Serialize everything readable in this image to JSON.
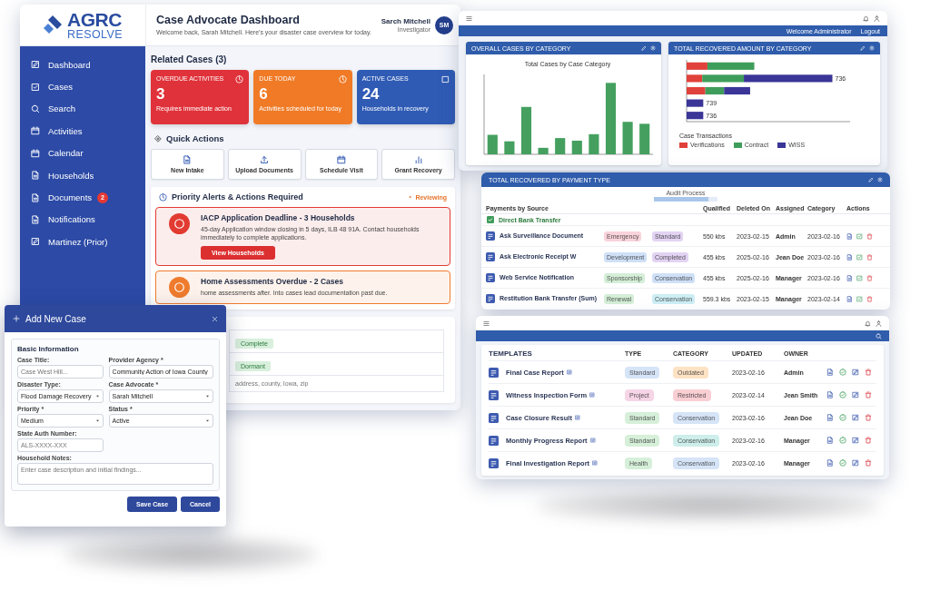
{
  "dashboard": {
    "logo": {
      "line1": "AGRC",
      "line2": "RESOLVE"
    },
    "title": "Case Advocate Dashboard",
    "subtitle": "Welcome back, Sarah Mitchell. Here's your disaster case overview for today.",
    "user": {
      "name": "Sarch Mitchell",
      "role": "Investigator",
      "initials": "SM"
    },
    "sidebar": {
      "items": [
        {
          "label": "Dashboard"
        },
        {
          "label": "Cases"
        },
        {
          "label": "Search"
        },
        {
          "label": "Activities"
        },
        {
          "label": "Calendar"
        },
        {
          "label": "Households"
        },
        {
          "label": "Documents",
          "badge": "2"
        },
        {
          "label": "Notifications"
        },
        {
          "label": "Martinez (Prior)"
        }
      ]
    },
    "related_title": "Related Cases (3)",
    "stats": [
      {
        "label": "OVERDUE ACTIVITIES",
        "value": "3",
        "caption": "Requires immediate action",
        "color": "#e0323a"
      },
      {
        "label": "DUE TODAY",
        "value": "6",
        "caption": "Activities scheduled for today",
        "color": "#f07a26"
      },
      {
        "label": "ACTIVE CASES",
        "value": "24",
        "caption": "Households in recovery",
        "color": "#2f5bb5"
      }
    ],
    "quick_actions": {
      "title": "Quick Actions",
      "items": [
        {
          "label": "New Intake"
        },
        {
          "label": "Upload Documents"
        },
        {
          "label": "Schedule Visit"
        },
        {
          "label": "Grant Recovery"
        }
      ]
    },
    "alerts": {
      "title": "Priority Alerts & Actions Required",
      "link": "Reviewing",
      "items": [
        {
          "title": "IACP Application Deadline - 3 Households",
          "text": "45-day Application window closing in 5 days, ILB 48 91A. Contact households immediately to complete applications.",
          "button": "View Households",
          "color": "#e23b32"
        },
        {
          "title": "Home Assessments Overdue - 2 Cases",
          "text": "home assessments after. Into cases lead documentation past due.",
          "color": "#ef7b2d"
        }
      ]
    },
    "records": {
      "tags": [
        "Complete",
        "Dormant"
      ],
      "placeholder": "address, county, Iowa, zip"
    }
  },
  "dialog": {
    "title": "Add New Case",
    "section": "Basic Information",
    "fields": [
      {
        "label": "Case Title:",
        "kind": "text",
        "placeholder": "Case West Hill..."
      },
      {
        "label": "Provider Agency *",
        "kind": "text",
        "value": "Community Action of Iowa County"
      },
      {
        "label": "Disaster Type:",
        "kind": "select",
        "value": "Flood Damage Recovery"
      },
      {
        "label": "Case Advocate *",
        "kind": "select",
        "value": "Sarah Mitchell"
      },
      {
        "label": "Priority *",
        "kind": "select",
        "value": "Medium"
      },
      {
        "label": "Status *",
        "kind": "select",
        "value": "Active"
      },
      {
        "label": "State Auth Number:",
        "kind": "text",
        "placeholder": "ALS-XXXX-XXX"
      },
      {
        "label": "Household Notes:",
        "kind": "textarea",
        "placeholder": "Enter case description and initial findings..."
      }
    ],
    "buttons": [
      "Save Case",
      "Cancel"
    ]
  },
  "charts_window": {
    "nav": {
      "welcome": "Welcome Administrator",
      "logout": "Logout"
    },
    "panels": [
      {
        "title": "OVERALL CASES BY CATEGORY",
        "chart_title": "Total Cases by Case Category"
      },
      {
        "title": "TOTAL RECOVERED AMOUNT BY CATEGORY",
        "bar_labels": [
          "736",
          "739",
          "736"
        ],
        "legend": {
          "title": "Case Transactions",
          "items": [
            {
              "name": "Verifications",
              "color": "#e0413a"
            },
            {
              "name": "Contract",
              "color": "#3f9d5b"
            },
            {
              "name": "WISS",
              "color": "#3a3597"
            }
          ]
        }
      }
    ]
  },
  "payments_window": {
    "title": "TOTAL RECOVERED BY PAYMENT TYPE",
    "progress": {
      "label": "Audit Process",
      "level": 0.85
    },
    "columns": [
      "Payments by Source",
      "Qualified",
      "Deleted On",
      "Assigned",
      "Category",
      "Actions"
    ],
    "group": "Direct Bank Transfer",
    "rows": [
      {
        "name": "Ask Surveillance Document",
        "tags": [
          {
            "text": "Emergency",
            "color": "#f9d3dc"
          },
          {
            "text": "Standard",
            "color": "#e3d3f3"
          }
        ],
        "amount": "550 kbs",
        "date": "2023-02-15",
        "user": "Admin",
        "updated": "2023-02-16"
      },
      {
        "name": "Ask Electronic Receipt W",
        "tags": [
          {
            "text": "Development",
            "color": "#cfe0f7"
          },
          {
            "text": "Completed",
            "color": "#e3d3f3"
          }
        ],
        "amount": "455 kbs",
        "date": "2025-02-16",
        "user": "Jean Doe",
        "updated": "2023-02-16"
      },
      {
        "name": "Web Service Notification",
        "tags": [
          {
            "text": "Sponsorship",
            "color": "#d4eed7"
          },
          {
            "text": "Conservation",
            "color": "#cfe0f7"
          }
        ],
        "amount": "455 kbs",
        "date": "2025-02-16",
        "user": "Manager",
        "updated": "2023-02-16"
      },
      {
        "name": "Restitution Bank Transfer (Sum)",
        "tags": [
          {
            "text": "Renewal",
            "color": "#d4eed7"
          },
          {
            "text": "Conservation",
            "color": "#cdeef5"
          }
        ],
        "amount": "559.3 kbs",
        "date": "2023-02-15",
        "user": "Manager",
        "updated": "2023-02-14"
      }
    ]
  },
  "templates_window": {
    "title": "TEMPLATES",
    "columns": [
      "TYPE",
      "CATEGORY",
      "UPDATED",
      "OWNER"
    ],
    "rows": [
      {
        "name": "Final Case Report",
        "type": {
          "text": "Standard",
          "color": "#d6e4f7"
        },
        "category": {
          "text": "Outdated",
          "color": "#fde2c4"
        },
        "updated": "2023-02-16",
        "owner": "Admin"
      },
      {
        "name": "Witness Inspection Form",
        "type": {
          "text": "Project",
          "color": "#f6d5e6"
        },
        "category": {
          "text": "Restricted",
          "color": "#f9cfd4"
        },
        "updated": "2023-02-14",
        "owner": "Jean Smith"
      },
      {
        "name": "Case Closure Result",
        "type": {
          "text": "Standard",
          "color": "#d6efd9"
        },
        "category": {
          "text": "Conservation",
          "color": "#d6e4f7"
        },
        "updated": "2023-02-16",
        "owner": "Jean Doe"
      },
      {
        "name": "Monthly Progress Report",
        "type": {
          "text": "Standard",
          "color": "#d6efd9"
        },
        "category": {
          "text": "Conservation",
          "color": "#cdeeea"
        },
        "updated": "2023-02-16",
        "owner": "Manager"
      },
      {
        "name": "Final Investigation Report",
        "type": {
          "text": "Health",
          "color": "#d6efd9"
        },
        "category": {
          "text": "Conservation",
          "color": "#d6e4f7"
        },
        "updated": "2023-02-16",
        "owner": "Manager"
      }
    ]
  }
}
